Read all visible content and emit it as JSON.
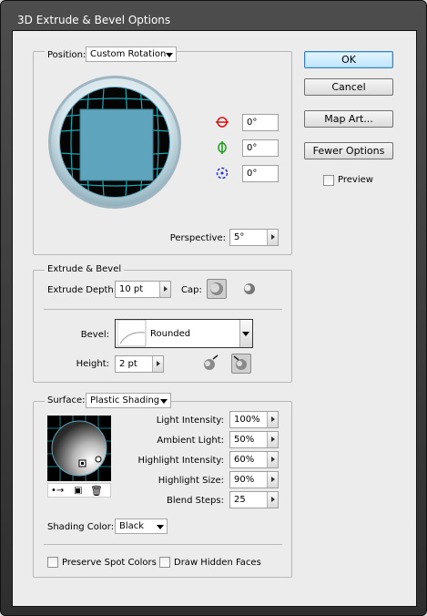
{
  "window": {
    "title": "3D Extrude & Bevel Options"
  },
  "buttons": {
    "ok": "OK",
    "cancel": "Cancel",
    "map_art": "Map Art...",
    "fewer_options": "Fewer Options"
  },
  "preview": {
    "label": "Preview",
    "checked": false
  },
  "position": {
    "label": "Position:",
    "select": "Custom Rotation",
    "x_rotation": "0°",
    "y_rotation": "0°",
    "z_rotation": "0°",
    "perspective_label": "Perspective:",
    "perspective": "5°"
  },
  "extrude": {
    "group_label": "Extrude & Bevel",
    "depth_label": "Extrude Depth:",
    "depth": "10 pt",
    "cap_label": "Cap:",
    "bevel_label": "Bevel:",
    "bevel": "Rounded",
    "height_label": "Height:",
    "height": "2 pt"
  },
  "surface": {
    "label": "Surface:",
    "select": "Plastic Shading",
    "light_intensity_label": "Light Intensity:",
    "light_intensity": "100%",
    "ambient_light_label": "Ambient Light:",
    "ambient_light": "50%",
    "highlight_intensity_label": "Highlight Intensity:",
    "highlight_intensity": "60%",
    "highlight_size_label": "Highlight Size:",
    "highlight_size": "90%",
    "blend_steps_label": "Blend Steps:",
    "blend_steps": "25",
    "shading_color_label": "Shading Color:",
    "shading_color": "Black",
    "preserve_spot_label": "Preserve Spot Colors",
    "draw_hidden_label": "Draw Hidden Faces"
  },
  "colors": {
    "accent": "#5ba3bb",
    "cube_face": "#5ea4bd",
    "grid": "#1ea7b5"
  }
}
